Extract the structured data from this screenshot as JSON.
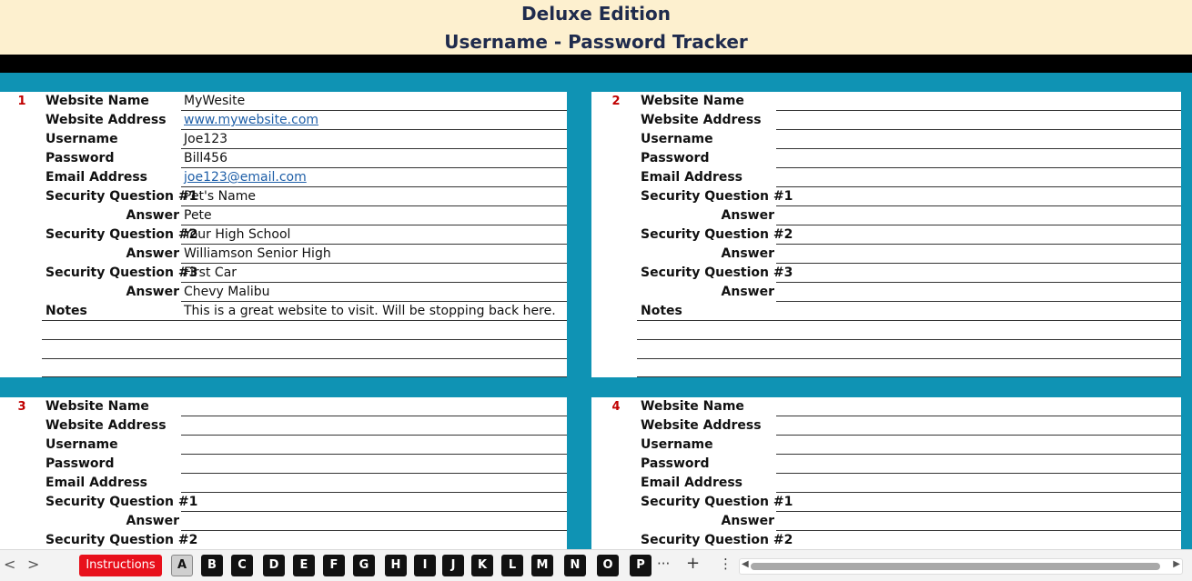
{
  "header": {
    "title_line1": "Deluxe Edition",
    "title_line2": "Username - Password Tracker"
  },
  "labels": {
    "website_name": "Website Name",
    "website_address": "Website Address",
    "username": "Username",
    "password": "Password",
    "email": "Email Address",
    "sq1": "Security Question #1",
    "answer": "Answer",
    "sq2": "Security Question #2",
    "sq3": "Security Question #3",
    "notes": "Notes"
  },
  "cards": [
    {
      "number": "1",
      "website_name": "MyWesite",
      "website_address": "www.mywebsite.com",
      "username": "Joe123",
      "password": "Bill456",
      "email": "joe123@email.com",
      "sq1": "Pet's Name",
      "a1": "Pete",
      "sq2": "Your High School",
      "a2": "Williamson Senior High",
      "sq3": "First Car",
      "a3": "Chevy Malibu",
      "notes": "This is a great website to visit. Will be stopping back here."
    },
    {
      "number": "2"
    },
    {
      "number": "3"
    },
    {
      "number": "4"
    }
  ],
  "bottom_bar": {
    "nav_prev": "<",
    "nav_next": ">",
    "instructions_label": "Instructions",
    "tabs": [
      "A",
      "B",
      "C",
      "D",
      "E",
      "F",
      "G",
      "H",
      "I",
      "J",
      "K",
      "L",
      "M",
      "N",
      "O",
      "P"
    ],
    "active_tab": "A",
    "more_label": "···",
    "add_label": "+",
    "menu_label": "⋮",
    "scroll_left": "◀",
    "scroll_right": "▶"
  }
}
